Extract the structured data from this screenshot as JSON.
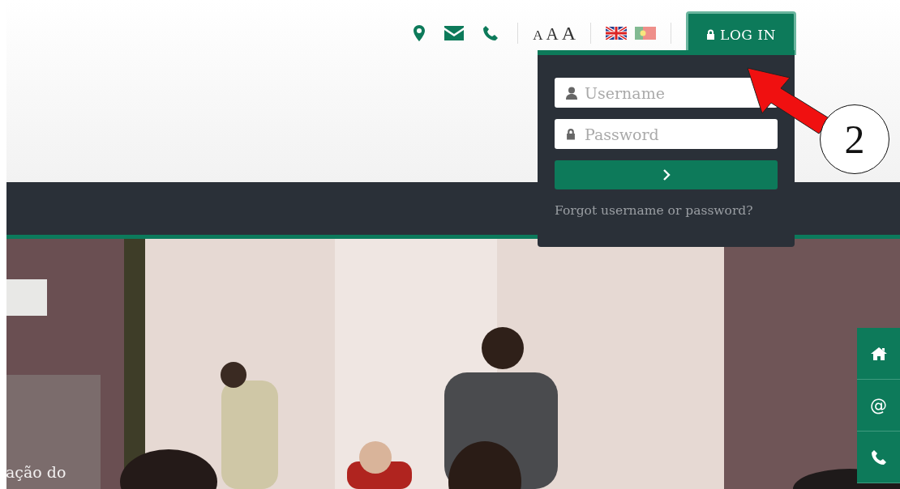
{
  "top_bar": {
    "font_sizes": [
      "A",
      "A",
      "A"
    ],
    "languages": [
      {
        "kind": "uk",
        "selected": true
      },
      {
        "kind": "pt",
        "selected": false
      }
    ]
  },
  "login": {
    "label": "LOG IN",
    "expanded": true
  },
  "login_form": {
    "username": {
      "placeholder": "Username"
    },
    "password": {
      "placeholder": "Password"
    },
    "forgot_link": "Forgot username or password?"
  },
  "hero": {
    "caption": "ação do"
  },
  "side_buttons": [
    {
      "kind": "home"
    },
    {
      "kind": "at",
      "label": "@"
    },
    {
      "kind": "phone"
    }
  ],
  "annotation": {
    "number": "2"
  }
}
